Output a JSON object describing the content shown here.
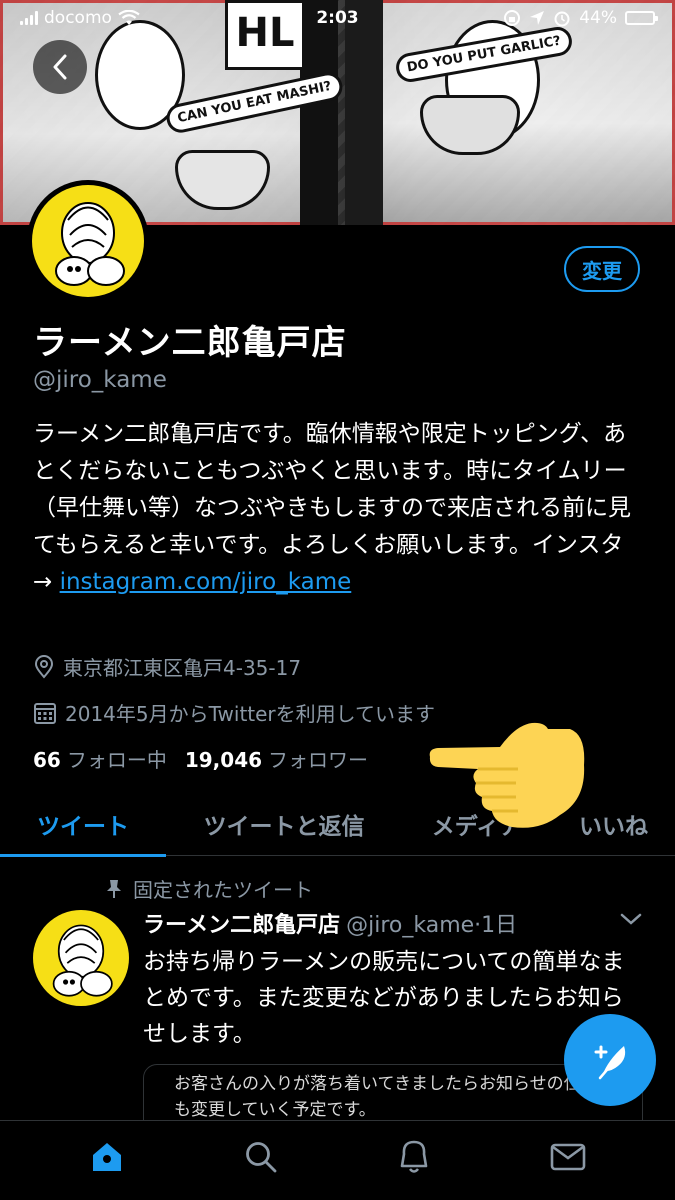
{
  "status_bar": {
    "carrier": "docomo",
    "time": "2:03",
    "battery": "44%",
    "battery_level": 0.44
  },
  "banner": {
    "logo_text": "HL",
    "bubble_1": "CAN YOU EAT MASHI?",
    "bubble_2": "DO YOU PUT GARLIC?"
  },
  "profile": {
    "edit_label": "変更",
    "name": "ラーメン二郎亀戸店",
    "handle": "@jiro_kame",
    "bio_text": "ラーメン二郎亀戸店です。臨休情報や限定トッピング、あとくだらないこともつぶやくと思います。時にタイムリー（早仕舞い等）なつぶやきもしますので来店される前に見てもらえると幸いです。よろしくお願いします。インスタ→ ",
    "bio_link": "instagram.com/jiro_kame",
    "location": "東京都江東区亀戸4-35-17",
    "joined": "2014年5月からTwitterを利用しています",
    "following_count": "66",
    "following_label": "フォロー中",
    "followers_count": "19,046",
    "followers_label": "フォロワー"
  },
  "tabs": [
    {
      "label": "ツイート"
    },
    {
      "label": "ツイートと返信"
    },
    {
      "label": "メディア"
    },
    {
      "label": "いいね"
    }
  ],
  "pinned_tweet": {
    "pinned_label": "固定されたツイート",
    "name": "ラーメン二郎亀戸店",
    "handle_time": "@jiro_kame·1日",
    "text": "お持ち帰りラーメンの販売についての簡単なまとめです。また変更などがありましたらお知らせします。",
    "quote_text": "お客さんの入りが落ち着いてきましたらお知らせの仕方も変更していく予定です。"
  },
  "colors": {
    "accent": "#1d9bf0",
    "avatar_yellow": "#f6df16",
    "muted": "#8b98a5",
    "hand": "#fdd454"
  },
  "icons": [
    "back-chevron-icon",
    "location-pin-icon",
    "calendar-icon",
    "pin-icon",
    "chevron-down-icon",
    "compose-feather-icon",
    "home-icon",
    "search-icon",
    "bell-icon",
    "mail-icon"
  ]
}
